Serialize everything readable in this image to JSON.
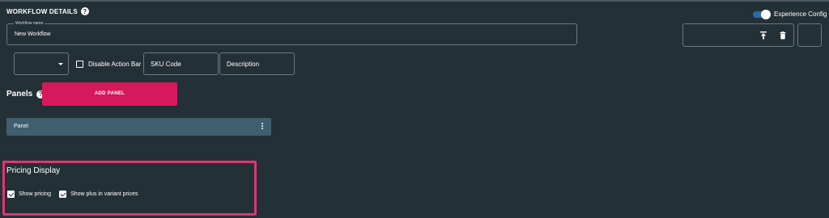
{
  "header": {
    "title": "WORKFLOW DETAILS",
    "help_icon": "help-circle-icon",
    "experience_config": {
      "label": "Experience Config",
      "enabled": true,
      "accent": "#2b6aa6"
    }
  },
  "workflow": {
    "name_label": "Workflow name",
    "name_value": "New Workflow"
  },
  "toolbar": {
    "upload_icon": "upload-icon",
    "delete_icon": "trash-icon"
  },
  "controls": {
    "dropdown_value": "",
    "disable_action_bar": {
      "label": "Disable Action Bar",
      "checked": false
    },
    "sku_code": "SKU Code",
    "description": "Description"
  },
  "panels": {
    "title": "Panels",
    "add_button": "ADD PANEL",
    "add_button_color": "#d5195a",
    "items": [
      {
        "label": "Panel"
      }
    ]
  },
  "pricing": {
    "title": "Pricing Display",
    "highlight_color": "#e23570",
    "options": [
      {
        "label": "Show pricing",
        "checked": true
      },
      {
        "label": "Show plus in variant prices",
        "checked": true
      }
    ]
  }
}
